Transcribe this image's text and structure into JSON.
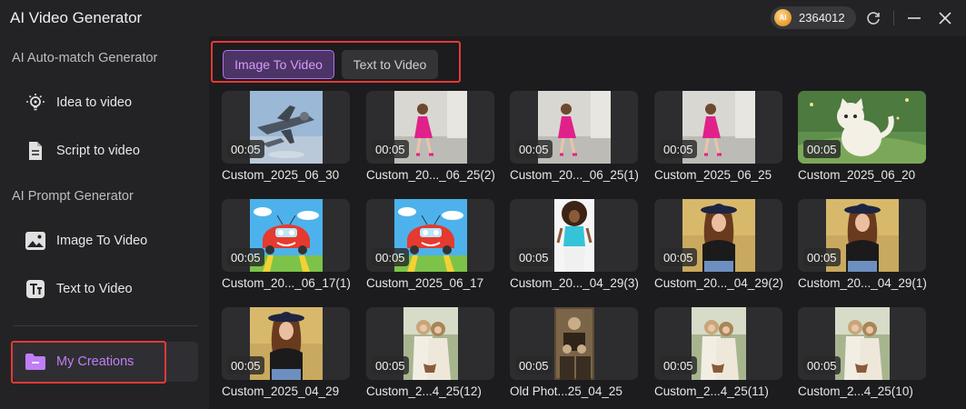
{
  "app": {
    "title": "AI Video Generator",
    "credits": "2364012",
    "coin_label": "AI"
  },
  "sidebar": {
    "section1": "AI Auto-match Generator",
    "section2": "AI Prompt Generator",
    "items": [
      {
        "label": "Idea to video",
        "icon": "lightbulb-icon"
      },
      {
        "label": "Script to video",
        "icon": "document-icon"
      },
      {
        "label": "Image To Video",
        "icon": "image-icon"
      },
      {
        "label": "Text to Video",
        "icon": "text-icon"
      },
      {
        "label": "My Creations",
        "icon": "folder-icon"
      }
    ]
  },
  "tabs": {
    "image_to_video": "Image To Video",
    "text_to_video": "Text to Video"
  },
  "grid": [
    {
      "duration": "00:05",
      "title": "Custom_2025_06_30",
      "thumb": "jet"
    },
    {
      "duration": "00:05",
      "title": "Custom_20..._06_25(2)",
      "thumb": "girl-pink"
    },
    {
      "duration": "00:05",
      "title": "Custom_20..._06_25(1)",
      "thumb": "girl-pink"
    },
    {
      "duration": "00:05",
      "title": "Custom_2025_06_25",
      "thumb": "girl-pink"
    },
    {
      "duration": "00:05",
      "title": "Custom_2025_06_20",
      "thumb": "cat"
    },
    {
      "duration": "00:05",
      "title": "Custom_20..._06_17(1)",
      "thumb": "car"
    },
    {
      "duration": "00:05",
      "title": "Custom_2025_06_17",
      "thumb": "car"
    },
    {
      "duration": "00:05",
      "title": "Custom_20..._04_29(3)",
      "thumb": "girl-curly"
    },
    {
      "duration": "00:05",
      "title": "Custom_20..._04_29(2)",
      "thumb": "woman-hat"
    },
    {
      "duration": "00:05",
      "title": "Custom_20..._04_29(1)",
      "thumb": "woman-hat"
    },
    {
      "duration": "00:05",
      "title": "Custom_2025_04_29",
      "thumb": "woman-hat"
    },
    {
      "duration": "00:05",
      "title": "Custom_2...4_25(12)",
      "thumb": "two-girls"
    },
    {
      "duration": "00:05",
      "title": "Old Phot...25_04_25",
      "thumb": "old-photo"
    },
    {
      "duration": "00:05",
      "title": "Custom_2...4_25(11)",
      "thumb": "two-girls"
    },
    {
      "duration": "00:05",
      "title": "Custom_2...4_25(10)",
      "thumb": "two-girls"
    }
  ]
}
